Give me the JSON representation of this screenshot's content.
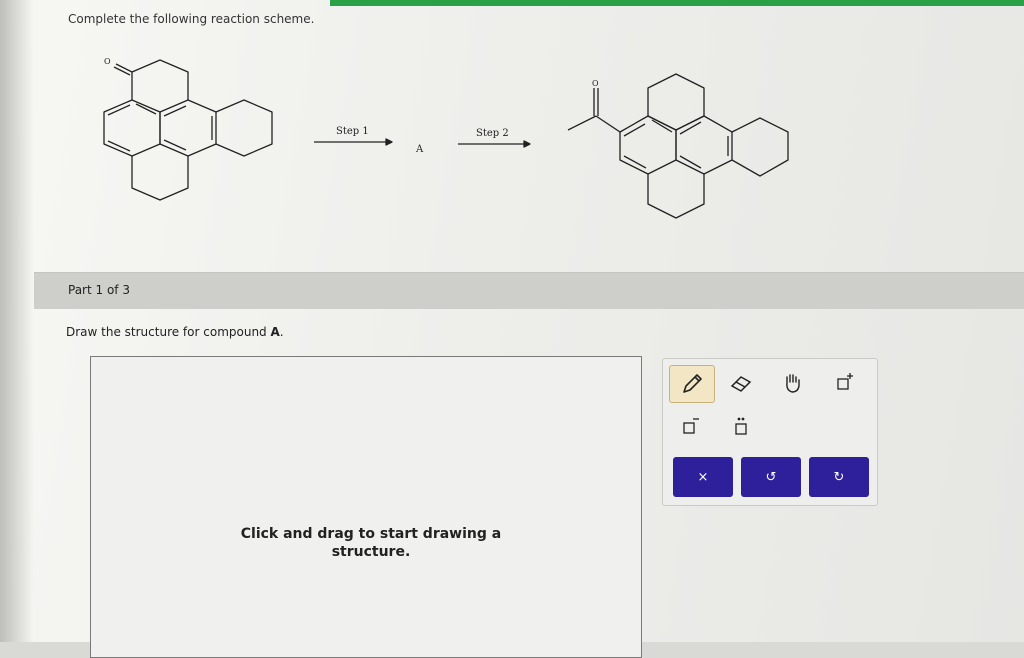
{
  "instruction": "Complete the following reaction scheme.",
  "scheme": {
    "step1_label": "Step 1",
    "step2_label": "Step 2",
    "intermediate_label": "A",
    "atom_o_start": "O",
    "atom_o_product": "O"
  },
  "part": {
    "label": "Part 1 of 3"
  },
  "question": {
    "text": "Draw the structure for compound ",
    "compound": "A",
    "suffix": "."
  },
  "canvas": {
    "hint": "Click and drag to start drawing a structure."
  },
  "toolbar": {
    "tools": [
      {
        "name": "pencil-icon",
        "active": true
      },
      {
        "name": "eraser-icon",
        "active": false
      },
      {
        "name": "hand-icon",
        "active": false
      },
      {
        "name": "add-charge-icon",
        "active": false
      },
      {
        "name": "remove-charge-icon",
        "active": false
      },
      {
        "name": "lone-pair-icon",
        "active": false
      }
    ],
    "clear_glyph": "×",
    "undo_glyph": "↺",
    "redo_glyph": "↻"
  },
  "colors": {
    "accent_green": "#2aa047",
    "button_blue": "#2e1f9a"
  }
}
